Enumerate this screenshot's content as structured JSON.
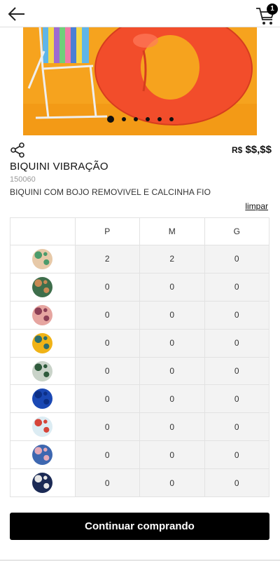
{
  "header": {
    "back_icon": "arrow-left-icon",
    "cart_icon": "cart-icon",
    "cart_count": "1"
  },
  "gallery": {
    "slide_count": 6,
    "active_slide": 1,
    "colors": {
      "background": "#f6a31e",
      "float": "#f24d2b"
    }
  },
  "product": {
    "share_icon": "share-icon",
    "currency": "R$",
    "price": "$$,$$",
    "name": "BIQUINI VIBRAÇÃO",
    "sku": "150060",
    "description": "BIQUINI COM BOJO REMOVIVEL E CALCINHA FIO"
  },
  "grid": {
    "clear_label": "limpar",
    "sizes": [
      "P",
      "M",
      "G"
    ],
    "rows": [
      {
        "swatch": "light-floral-print",
        "color": "#e7c9a8",
        "accent": "#4b9b6b",
        "qty": [
          "2",
          "2",
          "0"
        ]
      },
      {
        "swatch": "green-leaf-print",
        "color": "#3e6e4b",
        "accent": "#c98a55",
        "qty": [
          "0",
          "0",
          "0"
        ]
      },
      {
        "swatch": "pink-floral-print",
        "color": "#e6a5a0",
        "accent": "#8d3f55",
        "qty": [
          "0",
          "0",
          "0"
        ]
      },
      {
        "swatch": "yellow-tropical-print",
        "color": "#f0b317",
        "accent": "#2d6f6e",
        "qty": [
          "0",
          "0",
          "0"
        ]
      },
      {
        "swatch": "palm-leaf-print",
        "color": "#c9d3c9",
        "accent": "#2e5a3c",
        "qty": [
          "0",
          "0",
          "0"
        ]
      },
      {
        "swatch": "solid-royal-blue",
        "color": "#1a48b4",
        "accent": "#0c2f86",
        "qty": [
          "0",
          "0",
          "0"
        ]
      },
      {
        "swatch": "colorful-ditsy-print",
        "color": "#dcecf3",
        "accent": "#d6453a",
        "qty": [
          "0",
          "0",
          "0"
        ]
      },
      {
        "swatch": "blue-floral-print",
        "color": "#3d67b0",
        "accent": "#e4a9b8",
        "qty": [
          "0",
          "0",
          "0"
        ]
      },
      {
        "swatch": "navy-print",
        "color": "#1b2a55",
        "accent": "#e6e6e6",
        "qty": [
          "0",
          "0",
          "0"
        ]
      }
    ]
  },
  "footer": {
    "continue_label": "Continuar comprando"
  }
}
